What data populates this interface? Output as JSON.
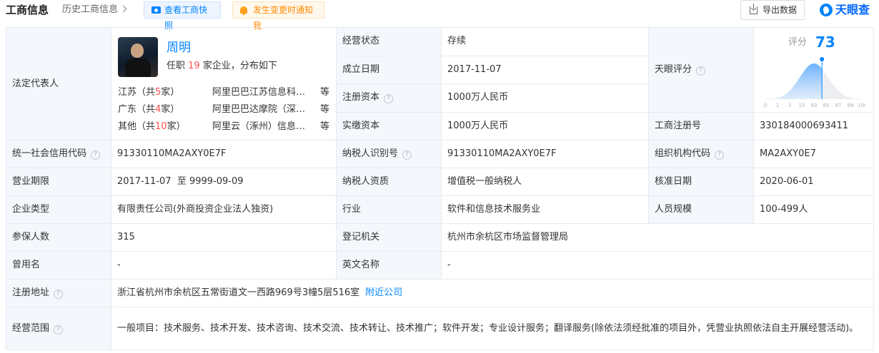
{
  "header": {
    "title": "工商信息",
    "history_link": "历史工商信息",
    "snapshot_button": "查看工商快照",
    "notify_button": "发生变更时通知我",
    "export_button": "导出数据",
    "brand": "天眼查"
  },
  "legal_rep": {
    "label": "法定代表人",
    "name": "周明",
    "role_prefix": "任职",
    "count": "19",
    "role_suffix": "家企业，分布如下",
    "regions": [
      {
        "name": "江苏（共",
        "count": "5",
        "suffix": "家）",
        "company": "阿里巴巴江苏信息科…",
        "etc": "等"
      },
      {
        "name": "广东（共",
        "count": "4",
        "suffix": "家）",
        "company": "阿里巴巴达摩院（深…",
        "etc": "等"
      },
      {
        "name": "其他（共",
        "count": "10",
        "suffix": "家）",
        "company": "阿里云（涿州）信息…",
        "etc": "等"
      }
    ]
  },
  "fields": {
    "status_label": "经营状态",
    "status": "存续",
    "founded_label": "成立日期",
    "founded": "2017-11-07",
    "reg_capital_label": "注册资本",
    "reg_capital": "1000万人民币",
    "paid_capital_label": "实缴资本",
    "paid_capital": "1000万人民币",
    "tianyan_score_label": "天眼评分",
    "biz_reg_no_label": "工商注册号",
    "biz_reg_no": "330184000693411",
    "credit_code_label": "统一社会信用代码",
    "credit_code": "91330110MA2AXY0E7F",
    "taxpayer_id_label": "纳税人识别号",
    "taxpayer_id": "91330110MA2AXY0E7F",
    "org_code_label": "组织机构代码",
    "org_code": "MA2AXY0E7",
    "term_label": "营业期限",
    "term": "2017-11-07  至 9999-09-09",
    "taxpayer_qual_label": "纳税人资质",
    "taxpayer_qual": "增值税一般纳税人",
    "approval_date_label": "核准日期",
    "approval_date": "2020-06-01",
    "company_type_label": "企业类型",
    "company_type": "有限责任公司(外商投资企业法人独资)",
    "industry_label": "行业",
    "industry": "软件和信息技术服务业",
    "staff_size_label": "人员规模",
    "staff_size": "100-499人",
    "insured_label": "参保人数",
    "insured": "315",
    "reg_authority_label": "登记机关",
    "reg_authority": "杭州市余杭区市场监督管理局",
    "former_name_label": "曾用名",
    "former_name": "-",
    "english_name_label": "英文名称",
    "english_name": "-",
    "address_label": "注册地址",
    "address": "浙江省杭州市余杭区五常街道文一西路969号3幢5层516室",
    "nearby_link": "附近公司",
    "scope_label": "经营范围",
    "scope": "一般项目：技术服务、技术开发、技术咨询、技术交流、技术转让、技术推广；软件开发；专业设计服务；翻译服务(除依法须经批准的项目外，凭营业执照依法自主开展经营活动)。"
  },
  "score": {
    "label": "评分",
    "value": 73,
    "ticks": [
      "0",
      "1",
      "3",
      "15",
      "50",
      "85",
      "97",
      "99",
      "100"
    ],
    "accent": "#0084ff"
  },
  "help_icon": "?"
}
